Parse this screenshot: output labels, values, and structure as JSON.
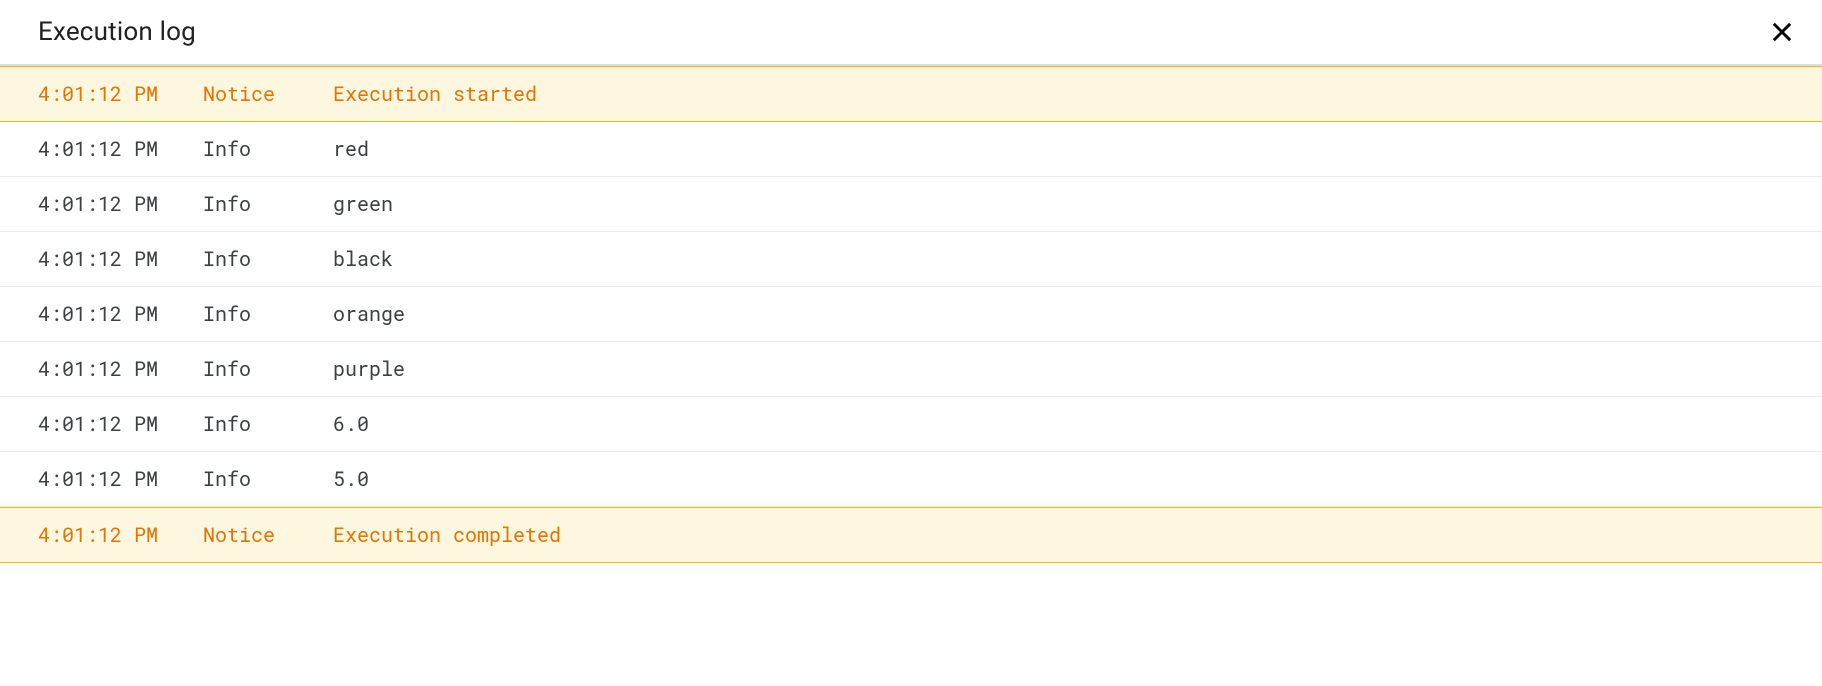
{
  "header": {
    "title": "Execution log"
  },
  "log": {
    "rows": [
      {
        "time": "4:01:12 PM",
        "level": "Notice",
        "message": "Execution started",
        "type": "notice"
      },
      {
        "time": "4:01:12 PM",
        "level": "Info",
        "message": "red",
        "type": "info"
      },
      {
        "time": "4:01:12 PM",
        "level": "Info",
        "message": "green",
        "type": "info"
      },
      {
        "time": "4:01:12 PM",
        "level": "Info",
        "message": "black",
        "type": "info"
      },
      {
        "time": "4:01:12 PM",
        "level": "Info",
        "message": "orange",
        "type": "info"
      },
      {
        "time": "4:01:12 PM",
        "level": "Info",
        "message": "purple",
        "type": "info"
      },
      {
        "time": "4:01:12 PM",
        "level": "Info",
        "message": "6.0",
        "type": "info"
      },
      {
        "time": "4:01:12 PM",
        "level": "Info",
        "message": "5.0",
        "type": "info"
      },
      {
        "time": "4:01:12 PM",
        "level": "Notice",
        "message": "Execution completed",
        "type": "notice"
      }
    ]
  }
}
